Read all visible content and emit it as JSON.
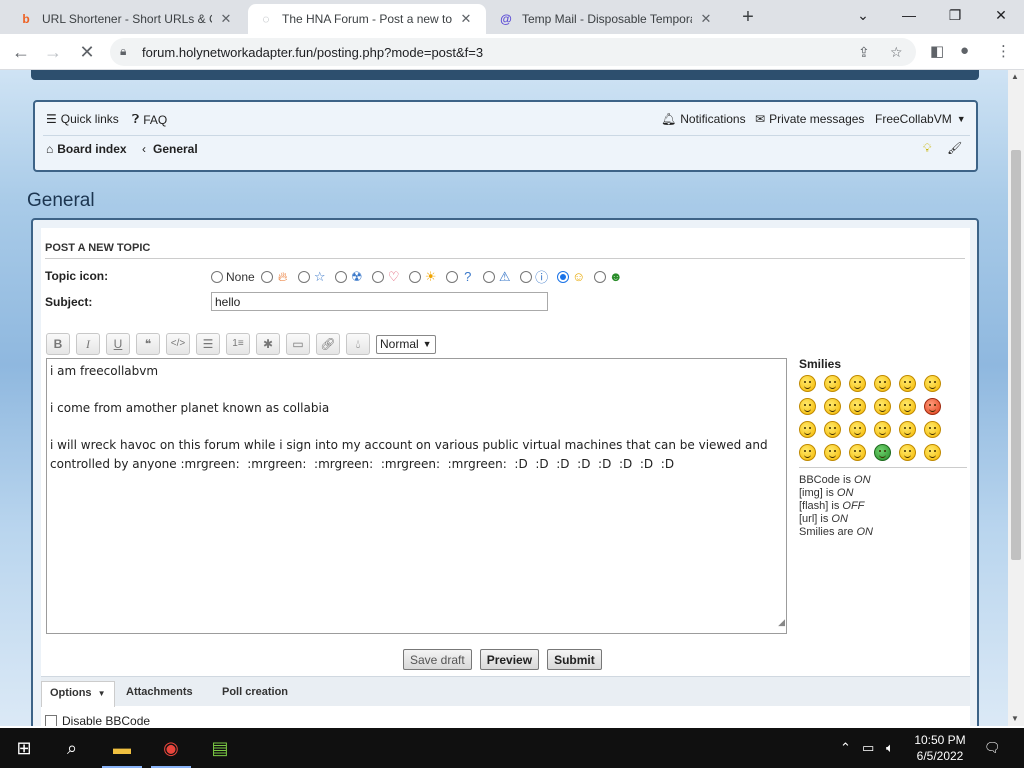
{
  "browser": {
    "tabs": [
      {
        "title": "URL Shortener - Short URLs & Cu",
        "icon": "bitly-icon"
      },
      {
        "title": "The HNA Forum - Post a new top",
        "icon": "loading-spinner-icon"
      },
      {
        "title": "Temp Mail - Disposable Tempora",
        "icon": "at-sign-icon"
      }
    ],
    "url": "forum.holynetworkadapter.fun/posting.php?mode=post&f=3"
  },
  "navbar": {
    "quick_links": "Quick links",
    "faq": "FAQ",
    "notifications": "Notifications",
    "private_messages": "Private messages",
    "username": "FreeCollabVM",
    "board_index": "Board index",
    "breadcrumb_current": "General"
  },
  "forum_title": "General",
  "post": {
    "heading": "POST A NEW TOPIC",
    "topic_icon_label": "Topic icon:",
    "topic_icon_none": "None",
    "subject_label": "Subject:",
    "subject_value": "hello",
    "font_size_select": "Normal",
    "message_lines": [
      "i am freecollabvm",
      "",
      "i come from amother planet known as collabia",
      "",
      "i will wreck havoc on this forum while i sign into my account on various public virtual machines that can be viewed and",
      "controlled by anyone :mrgreen:  :mrgreen:  :mrgreen:  :mrgreen:  :mrgreen:  :D  :D  :D  :D  :D  :D  :D  :D"
    ]
  },
  "smilies": {
    "title": "Smilies",
    "bbcode_status": [
      {
        "label": "BBCode is ",
        "value": "ON"
      },
      {
        "label": "[img] is ",
        "value": "ON"
      },
      {
        "label": "[flash] is ",
        "value": "OFF"
      },
      {
        "label": "[url] is ",
        "value": "ON"
      },
      {
        "label": "Smilies are ",
        "value": "ON"
      }
    ]
  },
  "buttons": {
    "save_draft": "Save draft",
    "preview": "Preview",
    "submit": "Submit"
  },
  "option_tabs": {
    "options": "Options",
    "attachments": "Attachments",
    "poll_creation": "Poll creation"
  },
  "disable_bbcode": "Disable BBCode",
  "taskbar": {
    "time": "10:50 PM",
    "date": "6/5/2022"
  }
}
